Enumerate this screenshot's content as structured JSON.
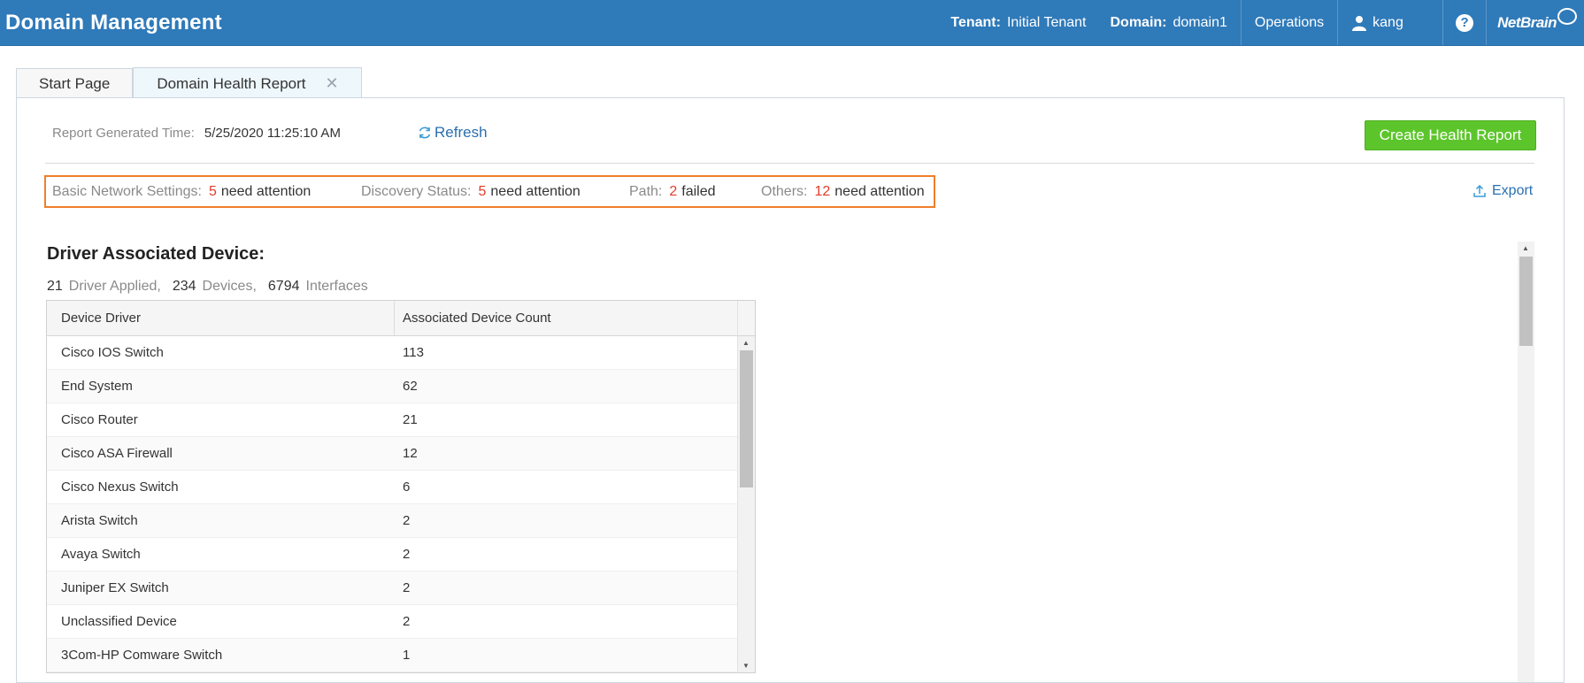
{
  "app": {
    "title": "Domain Management"
  },
  "header": {
    "tenant_label": "Tenant:",
    "tenant_value": "Initial Tenant",
    "domain_label": "Domain:",
    "domain_value": "domain1",
    "operations": "Operations",
    "user": "kang",
    "help": "?",
    "logo_text": "NetBrain"
  },
  "tabs": [
    {
      "label": "Start Page"
    },
    {
      "label": "Domain Health Report",
      "close": "✕"
    }
  ],
  "report": {
    "generated_label": "Report Generated Time:",
    "generated_value": "5/25/2020 11:25:10 AM",
    "refresh_label": "Refresh",
    "create_button": "Create Health Report",
    "export_label": "Export"
  },
  "summary": [
    {
      "label": "Basic Network Settings:",
      "count": "5",
      "text": "need attention"
    },
    {
      "label": "Discovery Status:",
      "count": "5",
      "text": "need attention"
    },
    {
      "label": "Path:",
      "count": "2",
      "text": "failed"
    },
    {
      "label": "Others:",
      "count": "12",
      "text": "need attention"
    }
  ],
  "section": {
    "title": "Driver Associated Device:",
    "stats": [
      {
        "num": "21",
        "label": "Driver Applied,"
      },
      {
        "num": "234",
        "label": "Devices,"
      },
      {
        "num": "6794",
        "label": "Interfaces"
      }
    ]
  },
  "table": {
    "columns": [
      "Device Driver",
      "Associated Device Count"
    ],
    "rows": [
      [
        "Cisco IOS Switch",
        "113"
      ],
      [
        "End System",
        "62"
      ],
      [
        "Cisco Router",
        "21"
      ],
      [
        "Cisco ASA Firewall",
        "12"
      ],
      [
        "Cisco Nexus Switch",
        "6"
      ],
      [
        "Arista Switch",
        "2"
      ],
      [
        "Avaya Switch",
        "2"
      ],
      [
        "Juniper EX Switch",
        "2"
      ],
      [
        "Unclassified Device",
        "2"
      ],
      [
        "3Com-HP Comware Switch",
        "1"
      ]
    ]
  },
  "colors": {
    "header_bg": "#2f7ab9",
    "highlight_border": "#f07e2a",
    "attention_red": "#e23c2c",
    "create_button_bg": "#5cc52b",
    "link_blue": "#2a6fb0"
  },
  "icons": {
    "user": "user-icon",
    "help": "help-icon",
    "refresh": "refresh-icon",
    "export": "export-icon",
    "close": "close-icon"
  }
}
